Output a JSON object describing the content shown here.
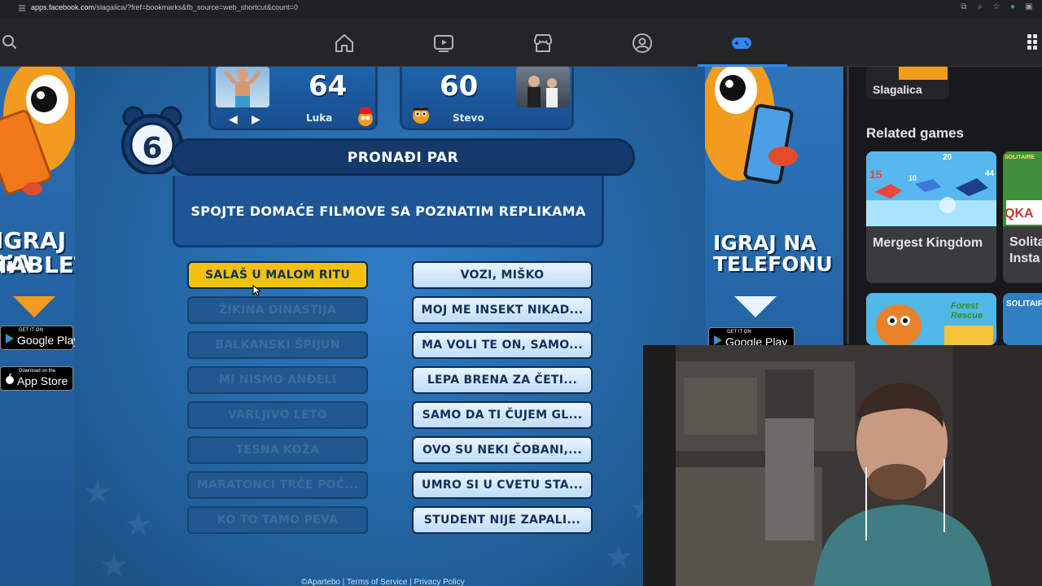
{
  "browser": {
    "url_host": "apps.facebook.com",
    "url_path": "/slagalica/?fref=bookmarks&fb_source=web_shortcut&count=0"
  },
  "nav": {
    "icons": [
      "home-icon",
      "video-icon",
      "marketplace-icon",
      "groups-icon",
      "gaming-icon"
    ],
    "active": "gaming-icon"
  },
  "left_ad": {
    "line1": "IGRAJ NA",
    "line2": "TABLETU",
    "google_small": "GET IT ON",
    "google_big": "Google Play",
    "apple_small": "Download on the",
    "apple_big": "App Store"
  },
  "right_ad": {
    "line1": "IGRAJ NA",
    "line2": "TELEFONU",
    "google_small": "GET IT ON",
    "google_big": "Google Play"
  },
  "players": [
    {
      "name": "Luka",
      "score": "64"
    },
    {
      "name": "Stevo",
      "score": "60"
    }
  ],
  "pager": {
    "prev": "◀",
    "next": "▶"
  },
  "timer": "6",
  "title": "PRONAĐI PAR",
  "question": "SPOJTE DOMAĆE FILMOVE SA POZNATIM REPLIKAMA",
  "left_items": [
    "SALAŠ U MALOM RITU",
    "ŽIKINA DINASTIJA",
    "BALKANSKI ŠPIJUN",
    "MI NISMO ANĐELI",
    "VARLJIVO LETO",
    "TESNA KOŽA",
    "MARATONCI TRČE POČ...",
    "KO TO TAMO PEVA"
  ],
  "right_items": [
    "VOZI, MIŠKO",
    "MOJ ME INSEKT NIKAD...",
    "MA VOLI TE ON, SAMO...",
    "LEPA BRENA ZA ČETI...",
    "SAMO DA TI ČUJEM GL...",
    "OVO SU NEKI ČOBANI,...",
    "UMRO SI U CVETU STA...",
    "STUDENT NIJE ZAPALI..."
  ],
  "active_left_index": 0,
  "footer": "©Apartebo | Terms of Service | Privacy Policy",
  "sidebar": {
    "current_game": "Slagalica",
    "related_title": "Related games",
    "games": [
      "Mergest Kingdom",
      "Solita Insta"
    ],
    "thumb_text": [
      "15",
      "10",
      "44",
      "20",
      "Forest Rescue",
      "SOLITAIRE",
      "QKA"
    ]
  },
  "colors": {
    "accent": "#2d88ff",
    "active_option": "#f4c20d",
    "game_bg": "#22639f"
  }
}
